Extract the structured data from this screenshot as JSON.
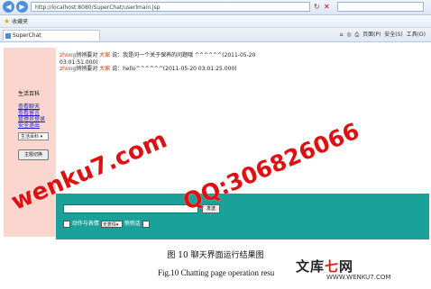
{
  "browser": {
    "url": "http://localhost:8080/SuperChat/userlmain.jsp",
    "favorites_label": "收藏夹",
    "tab_title": "SuperChat",
    "cmd_page": "页面(P)",
    "cmd_safety": "安全(S)",
    "cmd_tools": "工具(O)"
  },
  "sidebar": {
    "title": "生活百科",
    "links": [
      "查看聊天",
      "查看留言",
      "管理员登录",
      "安全退出"
    ],
    "select_value": "生活百科",
    "button_label": "主题切换"
  },
  "chat": {
    "messages": [
      {
        "user": "zhong",
        "mid": "悄悄要对",
        "target": "大家",
        "said": "说：",
        "text": "我是问一个关于保养的问题哦 ^^^^^^(2011-05-20 03:01:51.000)"
      },
      {
        "user": "zhong",
        "mid": "悄悄要对",
        "target": "大家",
        "said": "说：",
        "text": "hello^^^^^^(2011-05-20 03:01:25.000)"
      }
    ]
  },
  "input_bar": {
    "send_label": "发送",
    "action_label": "动作与表情",
    "select_value": "无表情",
    "private_label": "悄悄话"
  },
  "captions": {
    "cn": "图 10 聊天界面运行结果图",
    "en": "Fig.10 Chatting page operation resu"
  },
  "watermarks": {
    "left": "wenku7.com",
    "right": "QQ:306826066",
    "logo_pre": "文库",
    "logo_seven": "七",
    "logo_post": "网",
    "logo_url": "WWW.WENKU7.COM"
  },
  "colors": {
    "sidebar_bg": "#fbd6cf",
    "input_bar_bg": "#1aa19a",
    "watermark": "#dd1111"
  }
}
